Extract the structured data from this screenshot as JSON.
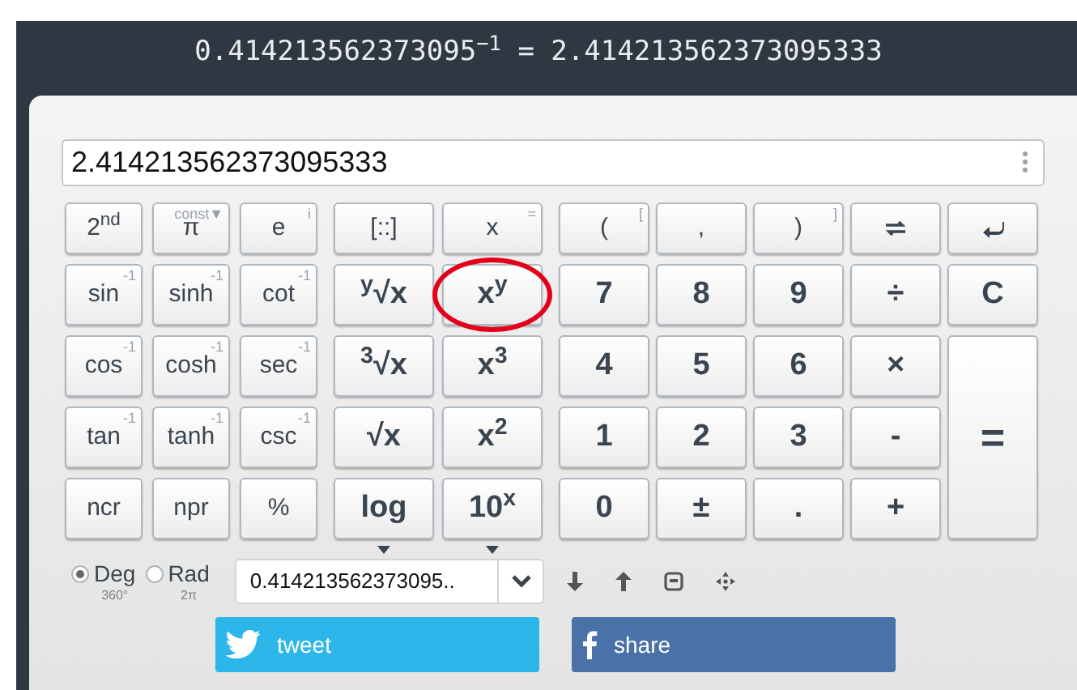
{
  "header": {
    "expression": "0.414213562373095$^{−1}$ = 2.414213562373095333"
  },
  "display": {
    "value": "2.414213562373095333"
  },
  "key_groups": [
    {
      "keys": [
        {
          "label": "2$^{nd}$",
          "kind": "plain",
          "circled": false
        },
        {
          "label": "π",
          "hint": "const▼",
          "kind": "plain",
          "circled": false
        },
        {
          "label": "e",
          "hint": "i",
          "kind": "plain",
          "circled": false
        },
        {
          "label": "sin",
          "hint": "-1",
          "kind": "plain",
          "circled": false
        },
        {
          "label": "sinh",
          "hint": "-1",
          "kind": "plain",
          "circled": false
        },
        {
          "label": "cot",
          "hint": "-1",
          "kind": "plain",
          "circled": false
        },
        {
          "label": "cos",
          "hint": "-1",
          "kind": "plain",
          "circled": false
        },
        {
          "label": "cosh",
          "hint": "-1",
          "kind": "plain",
          "circled": false
        },
        {
          "label": "sec",
          "hint": "-1",
          "kind": "plain",
          "circled": false
        },
        {
          "label": "tan",
          "hint": "-1",
          "kind": "plain",
          "circled": false
        },
        {
          "label": "tanh",
          "hint": "-1",
          "kind": "plain",
          "circled": false
        },
        {
          "label": "csc",
          "hint": "-1",
          "kind": "plain",
          "circled": false
        },
        {
          "label": "ncr",
          "kind": "plain",
          "circled": false
        },
        {
          "label": "npr",
          "kind": "plain",
          "circled": false
        },
        {
          "label": "%",
          "kind": "plain",
          "circled": false
        }
      ]
    },
    {
      "keys": [
        {
          "label": "[::]",
          "kind": "plain",
          "circled": false
        },
        {
          "label": "x",
          "hint": "=",
          "kind": "plain",
          "circled": false
        },
        {
          "label": "$^{y}$√x",
          "kind": "bold",
          "circled": false
        },
        {
          "label": "x$^{y}$",
          "kind": "bold",
          "circled": true
        },
        {
          "label": "$^{3}$√x",
          "kind": "bold",
          "circled": false
        },
        {
          "label": "x$^{3}$",
          "kind": "bold",
          "circled": false
        },
        {
          "label": "√x",
          "kind": "bold",
          "circled": false
        },
        {
          "label": "x$^{2}$",
          "kind": "bold",
          "circled": false
        },
        {
          "label": "log",
          "kind": "menu",
          "circled": false
        },
        {
          "label": "10$^{x}$",
          "kind": "menu",
          "circled": false
        }
      ]
    },
    {
      "keys": [
        {
          "label": "(",
          "hint": "[",
          "kind": "plain",
          "circled": false
        },
        {
          "label": ",",
          "kind": "plain",
          "circled": false
        },
        {
          "label": ")",
          "hint": "]",
          "kind": "plain",
          "circled": false
        },
        {
          "kind": "swap",
          "circled": false
        },
        {
          "kind": "back",
          "circled": false
        },
        {
          "label": "7",
          "kind": "bold",
          "circled": false
        },
        {
          "label": "8",
          "kind": "bold",
          "circled": false
        },
        {
          "label": "9",
          "kind": "bold",
          "circled": false
        },
        {
          "label": "÷",
          "kind": "bold",
          "circled": false
        },
        {
          "label": "C",
          "kind": "bold",
          "circled": false
        },
        {
          "label": "4",
          "kind": "bold",
          "circled": false
        },
        {
          "label": "5",
          "kind": "bold",
          "circled": false
        },
        {
          "label": "6",
          "kind": "bold",
          "circled": false
        },
        {
          "label": "×",
          "kind": "bold",
          "circled": false
        },
        {
          "label": "1",
          "kind": "bold",
          "circled": false
        },
        {
          "label": "2",
          "kind": "bold",
          "circled": false
        },
        {
          "label": "3",
          "kind": "bold",
          "circled": false
        },
        {
          "label": "-",
          "kind": "bold",
          "circled": false
        },
        {
          "label": "0",
          "kind": "bold",
          "circled": false
        },
        {
          "label": "±",
          "kind": "bold",
          "circled": false
        },
        {
          "label": ".",
          "kind": "bold",
          "circled": false
        },
        {
          "label": "+",
          "kind": "bold",
          "circled": false
        },
        {
          "label": "=",
          "kind": "tall",
          "circled": false
        }
      ]
    }
  ],
  "angle_modes": [
    {
      "label": "Deg",
      "sub": "360°",
      "selected": true
    },
    {
      "label": "Rad",
      "sub": "2π",
      "selected": false
    }
  ],
  "history": {
    "value": "0.414213562373095.."
  },
  "share_buttons": [
    {
      "kind": "twitter",
      "label": "tweet"
    },
    {
      "kind": "facebook",
      "label": "share"
    }
  ]
}
